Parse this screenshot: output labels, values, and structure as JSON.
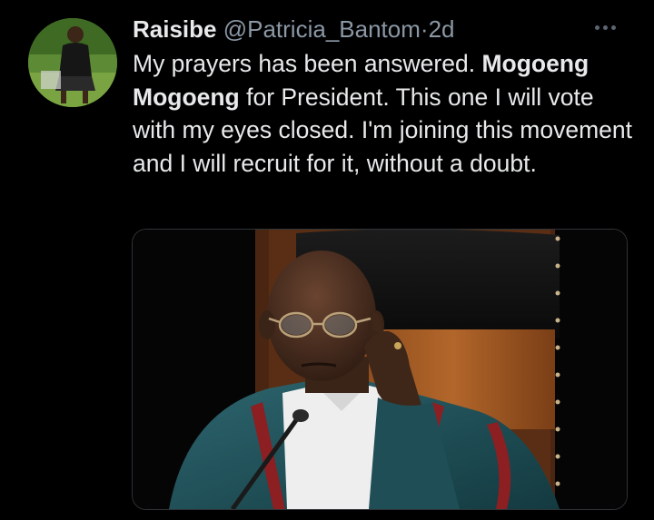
{
  "tweet": {
    "author_name": "Raisibe",
    "author_handle": "@Patricia_Bantom",
    "separator": "·",
    "timestamp": "2d",
    "text_part1": "My prayers has been answered. ",
    "text_bold": "Mogoeng Mogoeng",
    "text_part2": " for President. This one I will vote with my eyes closed. I'm joining this movement and I will recruit for it, without a doubt.",
    "more_icon": "more-horizontal-icon",
    "media_alt": "photo"
  },
  "colors": {
    "background": "#000000",
    "text": "#e7e9ea",
    "secondary_text": "#8b98a5"
  }
}
